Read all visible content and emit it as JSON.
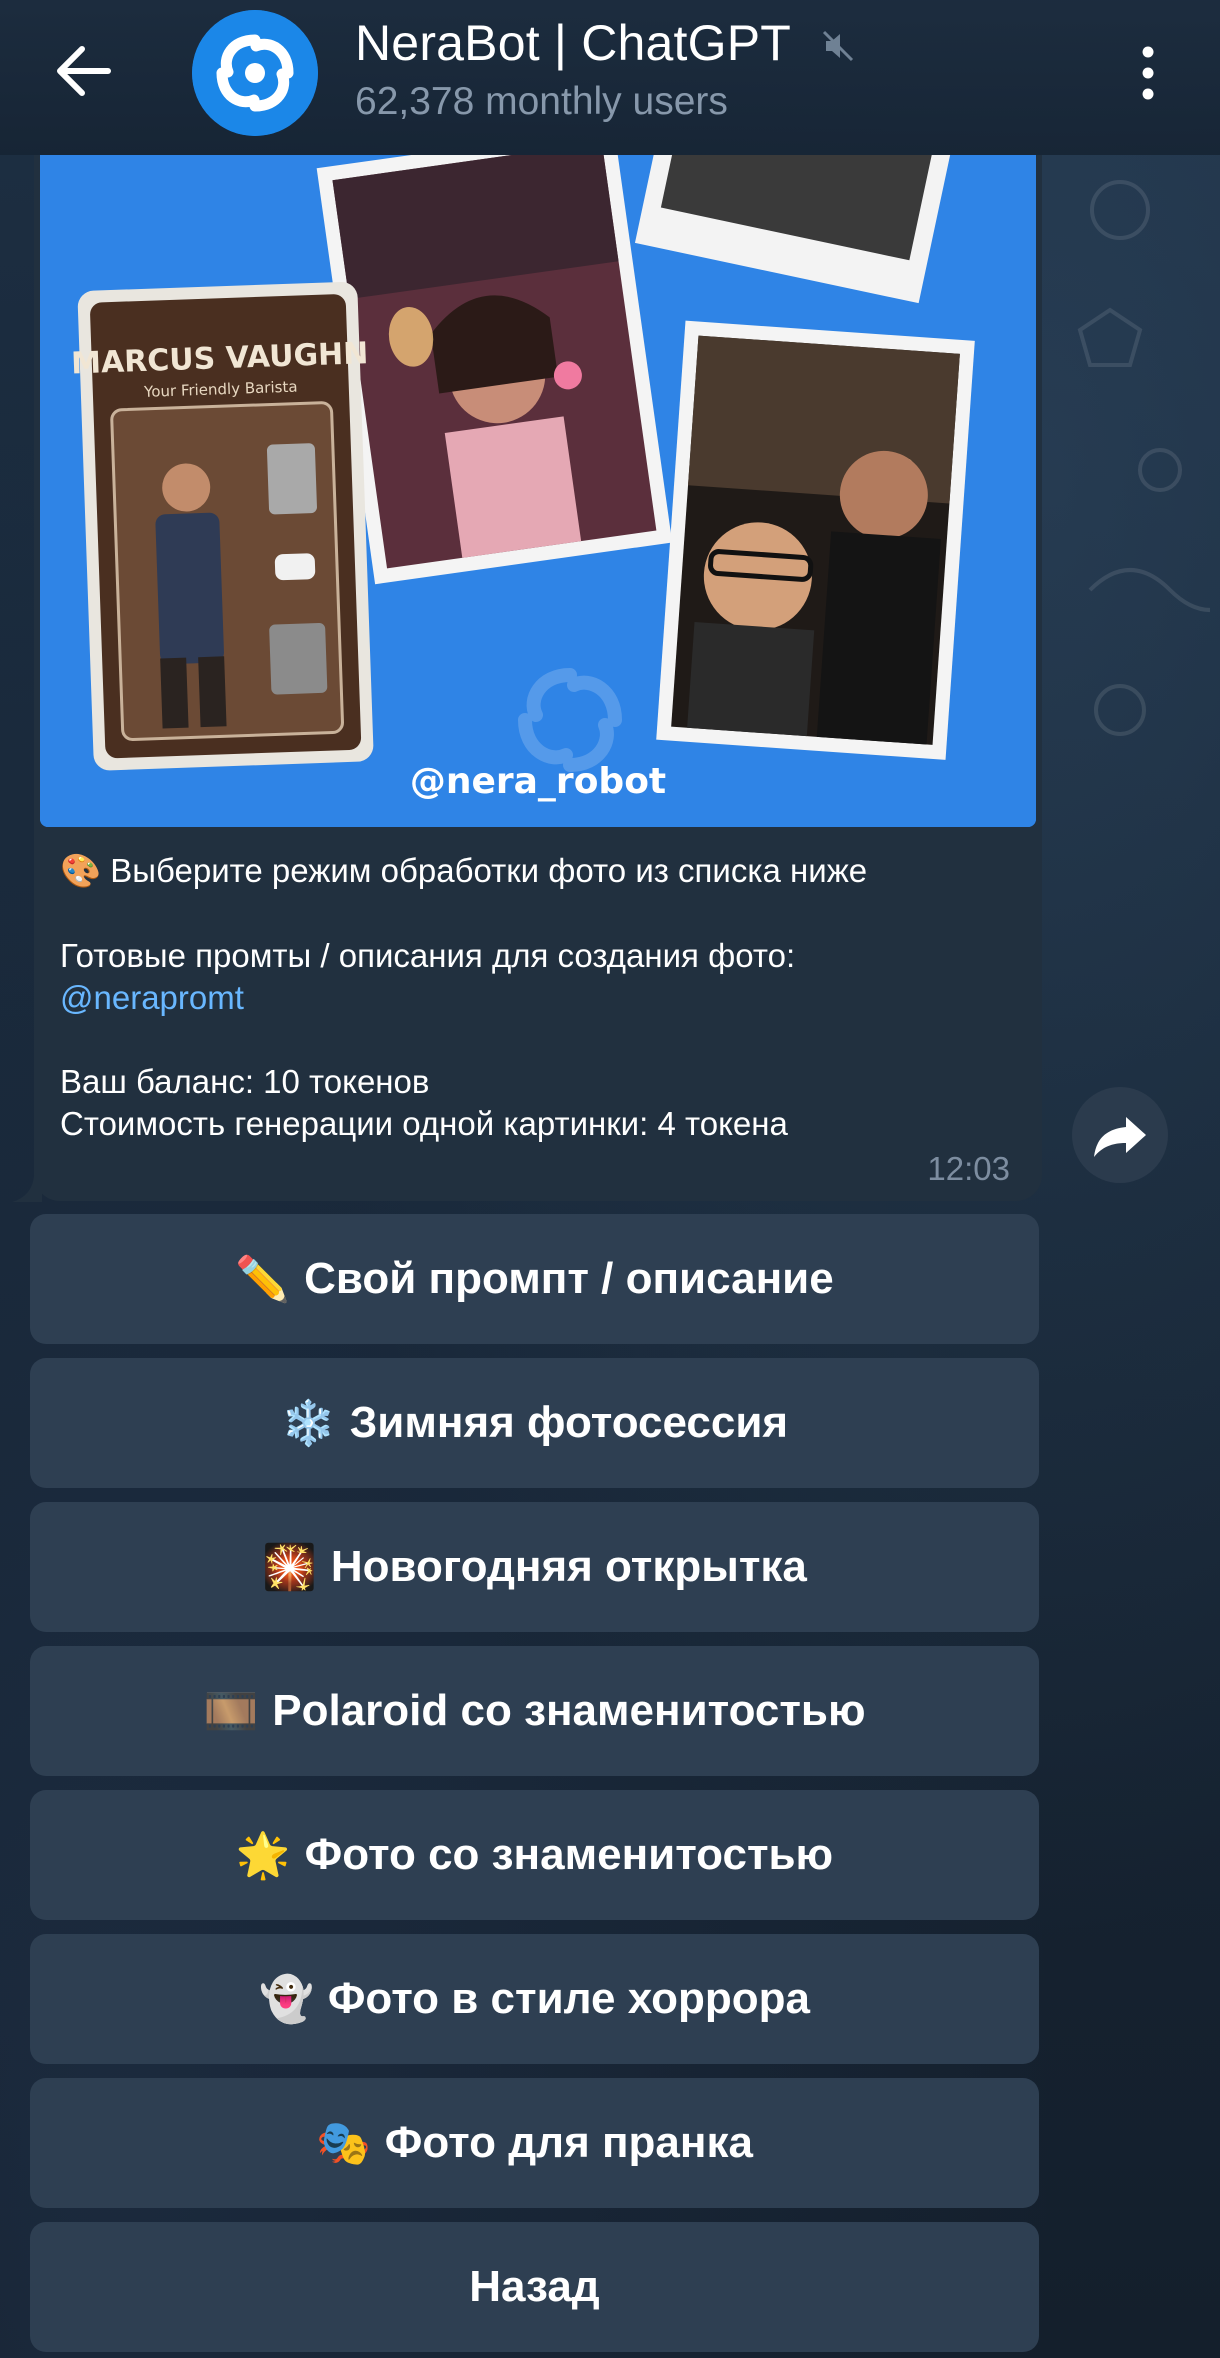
{
  "header": {
    "title": "NeraBot | ChatGPT",
    "subtitle": "62,378 monthly users"
  },
  "message": {
    "image_caption": "@nera_robot",
    "card_title": "MARCUS VAUGHN",
    "card_subtitle": "Your Friendly Barista",
    "line1": "Выберите режим обработки фото из списка ниже",
    "line2": "Готовые промты / описания для создания фото:",
    "link": "@nerapromt",
    "line3": "Ваш баланс: 10 токенов",
    "line4": "Стоимость генерации одной картинки: 4 токена",
    "time": "12:03"
  },
  "keyboard": [
    {
      "icon": "✏️",
      "icon_name": "pencil-icon",
      "label": "Свой промпт / описание"
    },
    {
      "icon": "❄️",
      "icon_name": "snowflake-icon",
      "label": "Зимняя фотосессия"
    },
    {
      "icon": "🎇",
      "icon_name": "fireworks-icon",
      "label": "Новогодняя открытка"
    },
    {
      "icon": "🎞️",
      "icon_name": "film-icon",
      "label": "Polaroid со знаменитостью"
    },
    {
      "icon": "🌟",
      "icon_name": "star-icon",
      "label": "Фото со знаменитостью"
    },
    {
      "icon": "👻",
      "icon_name": "ghost-icon",
      "label": "Фото в стиле хоррора"
    },
    {
      "icon": "🎭",
      "icon_name": "masks-icon",
      "label": "Фото для пранка"
    },
    {
      "icon": "",
      "icon_name": "",
      "label": "Назад"
    }
  ],
  "colors": {
    "accent": "#2f84e6",
    "link": "#69b7ff",
    "bubble": "#21303f",
    "button": "#2e3f52"
  }
}
